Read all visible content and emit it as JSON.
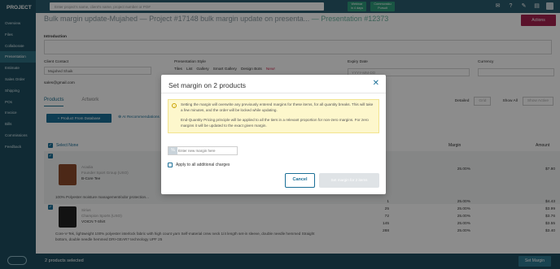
{
  "sidebar": {
    "brand": "PROJECT",
    "items": [
      {
        "label": "Overview"
      },
      {
        "label": "Files"
      },
      {
        "label": "Collaborate"
      },
      {
        "label": "Presentation",
        "active": true
      },
      {
        "label": "Estimate"
      },
      {
        "label": "Sales Order"
      },
      {
        "label": "Shipping"
      },
      {
        "label": "POs"
      },
      {
        "label": "Invoice"
      },
      {
        "label": "Bills"
      },
      {
        "label": "Commissions"
      },
      {
        "label": "Feedback"
      }
    ]
  },
  "topbar": {
    "search_placeholder": "Enter project's name, client's name, project number or PO#",
    "pill1": "Webinar\nin 4 days",
    "pill2": "Commonsku\nPursuit"
  },
  "page": {
    "title_part1": "Bulk margin update-Mujahed",
    "title_part2": " — Project #17148 bulk margin update on presenta...",
    "title_part3": " — Presentation #12373",
    "actions_label": "Actions",
    "introduction_label": "Introduction",
    "client_contact_label": "Client Contact",
    "client_contact_value": "Mujahed Shaik",
    "client_email": "sales@gmail.com",
    "presentation_style_label": "Presentation Style",
    "style_options": [
      "Tiles",
      "List",
      "Gallery",
      "Smart Gallery",
      "Design Bots"
    ],
    "style_new": "New!",
    "expiry_label": "Expiry Date",
    "expiry_placeholder": "YYYY-MM-DD",
    "currency_label": "Currency",
    "tabs": [
      "Products",
      "Artwork"
    ],
    "detailed_label": "Detailed",
    "grid_label": "Grid",
    "show_all_label": "Show All",
    "show_active_label": "Show Active",
    "product_db_label": "+ Product From Database",
    "ai_rec_label": "AI Recommendations",
    "select_none": "Select None",
    "margin_col": "Margin",
    "amount_col": "Amount"
  },
  "products": [
    {
      "name": "Acadia",
      "supplier": "Founder Sport Group (USO)",
      "code": "B-Core Tee",
      "desc": "100% Polyester moisture management/odor protection...",
      "margin": "25.00%",
      "amount": "$7.80"
    },
    {
      "name": "Sirius",
      "supplier": "Champion Sports (USO)",
      "code": "VOICN T-Shirt",
      "desc": "Core-V-Tek, lightweight 100% polyester interlock fabric with high count yarn Self-material crew neck 1/4 length set-in sleeve, double needle hemmed Straight bottom, double needle hemmed DRI-GEAR? technology UPF 25",
      "tiers": [
        {
          "qty": "1",
          "margin": "25.00%",
          "amount": "$4.43"
        },
        {
          "qty": "25",
          "margin": "25.00%",
          "amount": "$3.99"
        },
        {
          "qty": "72",
          "margin": "25.00%",
          "amount": "$3.76"
        },
        {
          "qty": "145",
          "margin": "25.00%",
          "amount": "$3.55"
        },
        {
          "qty": "288",
          "margin": "25.00%",
          "amount": "$3.40"
        }
      ]
    }
  ],
  "bottombar": {
    "selected_text": "2 products selected",
    "set_margin_label": "Set Margin"
  },
  "modal": {
    "title": "Set margin on 2 products",
    "warning_p1": "Setting the margin will overwrite any previously entered margins for these items, for all quantity breaks. This will take a few minutes, and the order will be locked while updating.",
    "warning_p2": "End-Quantity Pricing principle will be applied to all the tiers in a relevant proportion for non-zero margins. For zero margins it will be updated to the exact given margin.",
    "input_placeholder": "Enter new margin here",
    "percent_symbol": "%",
    "apply_label": "Apply to all additional charges",
    "cancel_label": "Cancel",
    "set_label": "Set margin for 2 items"
  },
  "colors": {
    "sidebar": "#1e4e5f",
    "accent": "#1b6f97",
    "actions": "#a5224f",
    "warning_bg": "#fdf7cc"
  }
}
